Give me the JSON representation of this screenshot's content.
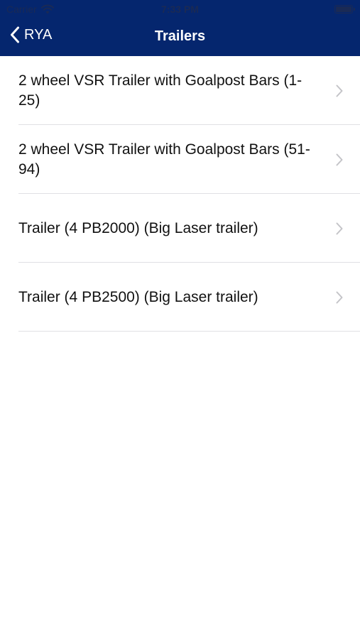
{
  "status_bar": {
    "carrier": "Carrier",
    "time": "7:33 PM"
  },
  "nav": {
    "back_label": "RYA",
    "title": "Trailers"
  },
  "items": [
    {
      "label": "2 wheel VSR Trailer with Goalpost Bars (1-25)"
    },
    {
      "label": "2 wheel VSR Trailer with Goalpost Bars (51-94)"
    },
    {
      "label": "Trailer (4 PB2000) (Big Laser trailer)"
    },
    {
      "label": "Trailer (4 PB2500) (Big Laser trailer)"
    }
  ],
  "colors": {
    "header_background": "#05266e",
    "header_text": "#ffffff",
    "separator": "#e0e0e4",
    "chevron": "#c4c4c8"
  },
  "icons": {
    "wifi": "wifi-icon",
    "battery": "battery-icon",
    "back": "back-chevron-icon",
    "disclosure": "chevron-right-icon"
  }
}
